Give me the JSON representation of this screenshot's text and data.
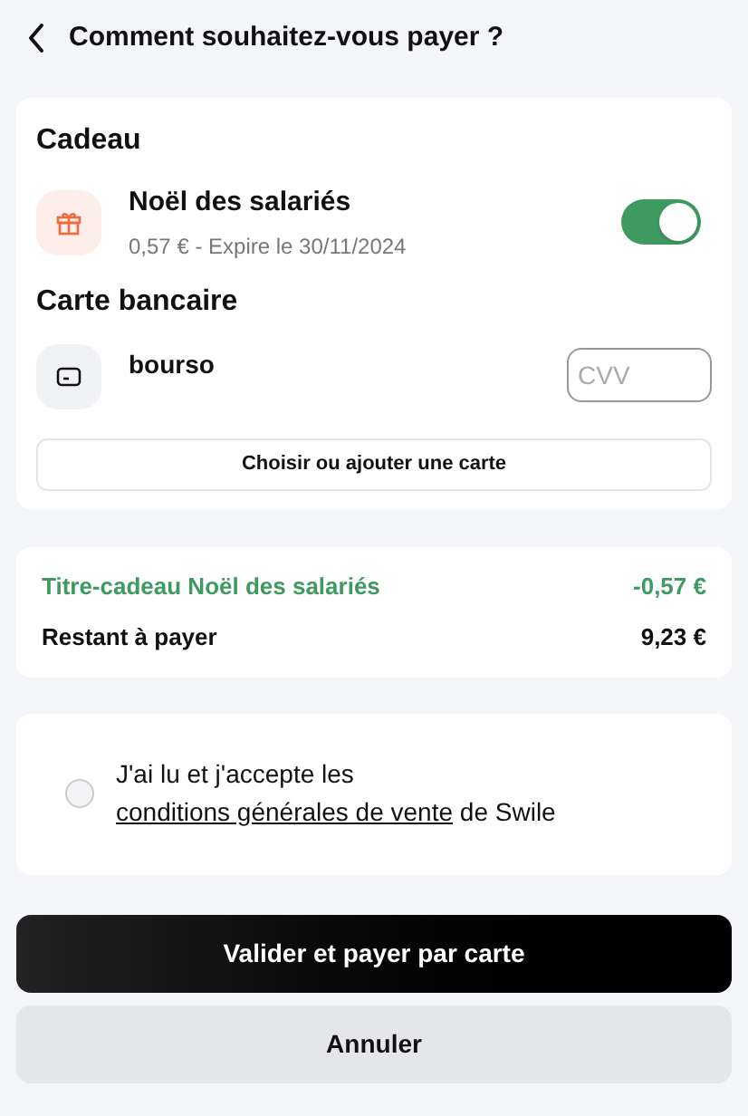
{
  "header": {
    "title": "Comment souhaitez-vous payer ?"
  },
  "gift": {
    "heading": "Cadeau",
    "name": "Noël des salariés",
    "details": "0,57 € - Expire le 30/11/2024",
    "on": true
  },
  "card": {
    "heading": "Carte bancaire",
    "name": "bourso",
    "cvv_placeholder": "CVV",
    "choose_button": "Choisir ou ajouter une carte"
  },
  "summary": [
    {
      "label": "Titre-cadeau Noël des salariés",
      "amount": "-0,57 €",
      "kind": "discount"
    },
    {
      "label": "Restant à payer",
      "amount": "9,23 €",
      "kind": "total"
    }
  ],
  "terms": {
    "before": "J'ai lu et j'accepte les ",
    "link": "conditions générales de vente",
    "after": " de Swile",
    "checked": false
  },
  "buttons": {
    "primary": "Valider et payer par carte",
    "secondary": "Annuler"
  }
}
